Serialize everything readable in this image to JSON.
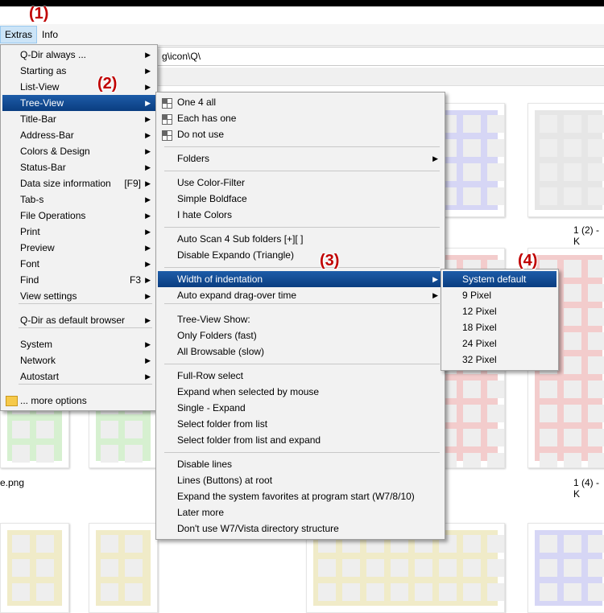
{
  "menubar": {
    "extras": "Extras",
    "info": "Info"
  },
  "address": {
    "path": "g\\icon\\Q\\"
  },
  "captions": [
    "1 (2) - K",
    "e.png",
    "1 (4) - K"
  ],
  "callouts": [
    "(1)",
    "(2)",
    "(3)",
    "(4)"
  ],
  "extras_menu": [
    {
      "label": "Q-Dir always ...",
      "submenu": true
    },
    {
      "label": "Starting as",
      "submenu": true
    },
    {
      "label": "List-View",
      "submenu": true
    },
    {
      "label": "Tree-View",
      "submenu": true,
      "selected": true
    },
    {
      "label": "Title-Bar",
      "submenu": true
    },
    {
      "label": "Address-Bar",
      "submenu": true
    },
    {
      "label": "Colors & Design",
      "submenu": true
    },
    {
      "label": "Status-Bar",
      "submenu": true
    },
    {
      "label": "Data size information",
      "shortcut": "[F9]",
      "submenu": true
    },
    {
      "label": "Tab-s",
      "submenu": true
    },
    {
      "label": "File Operations",
      "submenu": true
    },
    {
      "label": "Print",
      "submenu": true
    },
    {
      "label": "Preview",
      "submenu": true
    },
    {
      "label": "Font",
      "submenu": true
    },
    {
      "label": "Find",
      "shortcut": "F3",
      "submenu": true
    },
    {
      "label": "View settings",
      "submenu": true
    },
    {
      "label": "Q-Dir as default browser",
      "submenu": true
    },
    {
      "label": "System",
      "submenu": true
    },
    {
      "label": "Network",
      "submenu": true
    },
    {
      "label": "Autostart",
      "submenu": true
    },
    {
      "label": "... more options",
      "submenu": false
    }
  ],
  "treeview_menu": [
    {
      "label": "One 4 all",
      "icon": "grid-icon"
    },
    {
      "label": "Each has one",
      "icon": "grid-icon"
    },
    {
      "label": "Do not use",
      "icon": "grid-icon"
    },
    {
      "label": "Folders",
      "submenu": true
    },
    {
      "label": "Use Color-Filter"
    },
    {
      "label": "Simple Boldface"
    },
    {
      "label": "I hate Colors"
    },
    {
      "label": "Auto Scan 4 Sub folders  [+][ ]"
    },
    {
      "label": "Disable Expando (Triangle)"
    },
    {
      "label": "Width of indentation",
      "submenu": true,
      "selected": true
    },
    {
      "label": "Auto expand drag-over time",
      "submenu": true
    },
    {
      "label": "Tree-View Show:"
    },
    {
      "label": "Only Folders (fast)"
    },
    {
      "label": "All Browsable (slow)"
    },
    {
      "label": "Full-Row select"
    },
    {
      "label": "Expand when selected by mouse"
    },
    {
      "label": "Single - Expand"
    },
    {
      "label": "Select folder from list"
    },
    {
      "label": "Select folder from list and expand"
    },
    {
      "label": "Disable lines"
    },
    {
      "label": "Lines (Buttons) at root"
    },
    {
      "label": "Expand the system favorites at program start (W7/8/10)"
    },
    {
      "label": "Later more"
    },
    {
      "label": "Don't use W7/Vista directory structure"
    }
  ],
  "indent_menu": [
    {
      "label": "System default",
      "selected": true
    },
    {
      "label": "9 Pixel"
    },
    {
      "label": "12 Pixel"
    },
    {
      "label": "18 Pixel"
    },
    {
      "label": "24 Pixel"
    },
    {
      "label": "32 Pixel"
    }
  ],
  "colors": {
    "selection": "#0a3d80",
    "callout": "#c00000",
    "menu_bg": "#f2f2f2"
  }
}
